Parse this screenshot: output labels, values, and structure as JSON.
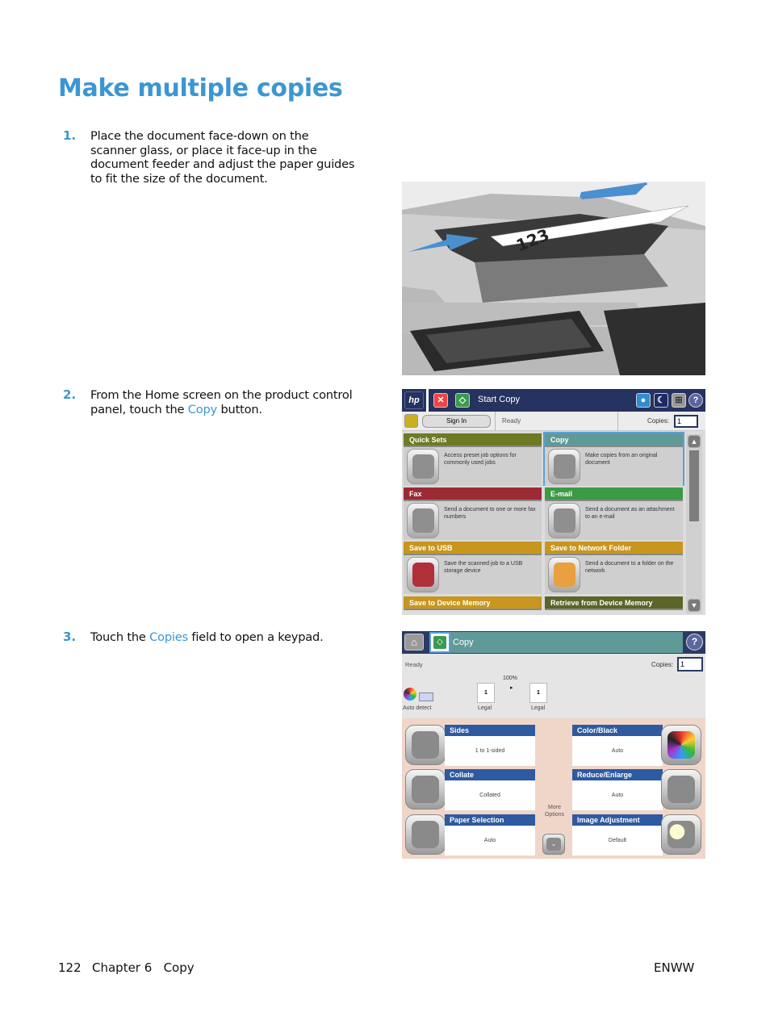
{
  "page": {
    "title": "Make multiple copies",
    "steps": [
      {
        "num": "1.",
        "text": "Place the document face-down on the scanner glass, or place it face-up in the document feeder and adjust the paper guides to fit the size of the document."
      },
      {
        "num": "2.",
        "pre": "From the Home screen on the product control panel, touch the ",
        "link": "Copy",
        "post": " button."
      },
      {
        "num": "3.",
        "pre": "Touch the ",
        "link": "Copies",
        "post": " field to open a keypad."
      }
    ],
    "photo_label": "123",
    "footer": {
      "page_number": "122",
      "chapter": "Chapter 6   Copy",
      "right": "ENWW"
    }
  },
  "home_screen": {
    "logo": "hp",
    "start_copy": "Start Copy",
    "sign_in": "Sign In",
    "status": "Ready",
    "copies_label": "Copies:",
    "copies_value": "1",
    "header_icons": [
      "stop-icon",
      "start-icon",
      "globe-icon",
      "sleep-icon",
      "network-icon",
      "help-icon"
    ],
    "tiles": [
      {
        "name": "Quick Sets",
        "desc": "Access preset job options for commonly used jobs",
        "color": "#6e7a24"
      },
      {
        "name": "Copy",
        "desc": "Make copies from an original document",
        "color": "#5f9a98",
        "selected": true
      },
      {
        "name": "Fax",
        "desc": "Send a document to one or more fax numbers",
        "color": "#9c2a34"
      },
      {
        "name": "E-mail",
        "desc": "Send a document as an attachment to an e-mail",
        "color": "#3c9a45"
      },
      {
        "name": "Save to USB",
        "desc": "Save the scanned job to a USB storage device",
        "color": "#c8961e"
      },
      {
        "name": "Save to Network Folder",
        "desc": "Send a document to a folder on the network",
        "color": "#c8961e"
      },
      {
        "name": "Save to Device Memory",
        "desc": "",
        "color": "#c8961e"
      },
      {
        "name": "Retrieve from Device Memory",
        "desc": "",
        "color": "#5c6428"
      }
    ]
  },
  "copy_screen": {
    "title": "Copy",
    "status": "Ready",
    "copies_label": "Copies:",
    "copies_value": "1",
    "zoom": "100%",
    "auto_detect": "Auto detect",
    "original": {
      "page": "1",
      "size": "Legal"
    },
    "output": {
      "page": "1",
      "size": "Legal"
    },
    "more_options": "More Options",
    "options_left": [
      {
        "name": "Sides",
        "value": "1 to 1-sided"
      },
      {
        "name": "Collate",
        "value": "Collated"
      },
      {
        "name": "Paper Selection",
        "value": "Auto"
      }
    ],
    "options_right": [
      {
        "name": "Color/Black",
        "value": "Auto"
      },
      {
        "name": "Reduce/Enlarge",
        "value": "Auto"
      },
      {
        "name": "Image Adjustment",
        "value": "Default"
      }
    ]
  }
}
